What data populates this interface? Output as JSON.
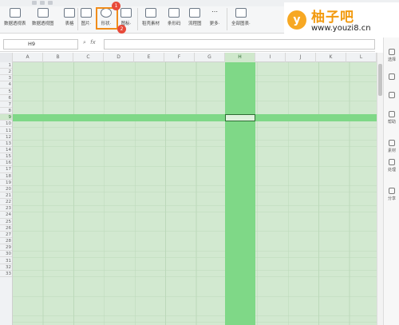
{
  "ribbon": {
    "tools": [
      {
        "label": "数据透视表",
        "icon": "pivot-table-icon"
      },
      {
        "label": "数据透视图",
        "icon": "pivot-chart-icon"
      },
      {
        "label": "表格",
        "icon": "table-icon"
      },
      {
        "label": "图片·",
        "icon": "picture-icon"
      },
      {
        "label": "形状·",
        "icon": "shapes-icon"
      },
      {
        "label": "图标·",
        "icon": "icons-icon"
      },
      {
        "label": "稻壳素材",
        "icon": "docer-material-icon"
      },
      {
        "label": "条形码",
        "icon": "barcode-icon"
      },
      {
        "label": "流程图",
        "icon": "flowchart-icon"
      },
      {
        "label": "更多·",
        "icon": "more-icon"
      },
      {
        "label": "全部图表·",
        "icon": "all-charts-icon"
      }
    ],
    "badges": [
      "1",
      "2"
    ]
  },
  "watermark": {
    "logo_letter": "y",
    "title": "柚子吧",
    "url": "www.youzi8.cn"
  },
  "formula_bar": {
    "cell_ref": "H9",
    "fx_label": "fx",
    "value": ""
  },
  "columns": [
    "A",
    "B",
    "C",
    "D",
    "E",
    "F",
    "G",
    "H",
    "I",
    "J",
    "K",
    "L"
  ],
  "rows": [
    "1",
    "2",
    "3",
    "4",
    "5",
    "6",
    "7",
    "8",
    "9",
    "10",
    "11",
    "12",
    "13",
    "14",
    "15",
    "16",
    "17",
    "18",
    "19",
    "20",
    "21",
    "22",
    "23",
    "24",
    "25",
    "26",
    "27",
    "28",
    "29",
    "30",
    "31",
    "32",
    "33"
  ],
  "selection": {
    "column": "H",
    "row": "9"
  },
  "colors": {
    "highlight": "#7fd887",
    "background_tint": "#d2e9d0",
    "accent_box": "#f08c1a",
    "badge": "#e84a3a"
  },
  "right_panel": [
    {
      "label": "选择",
      "icon": "cursor-icon"
    },
    {
      "label": "",
      "icon": "format-icon"
    },
    {
      "label": "",
      "icon": "property-icon"
    },
    {
      "label": "帮助",
      "icon": "help-icon"
    },
    {
      "label": "素材",
      "icon": "material-icon"
    },
    {
      "label": "处理",
      "icon": "process-icon"
    },
    {
      "label": "分享",
      "icon": "share-icon"
    }
  ]
}
